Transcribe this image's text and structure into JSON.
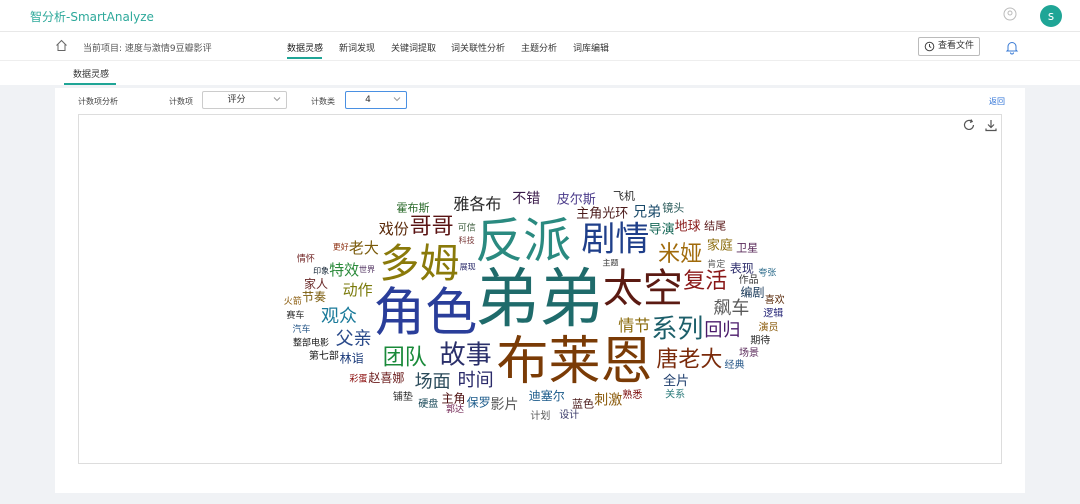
{
  "app": {
    "title": "智分析-SmartAnalyze",
    "avatar_letter": "s",
    "accent": "#1fa596"
  },
  "nav": {
    "project_label": "当前项目: 速度与激情9豆瓣影评",
    "tabs": [
      {
        "label": "数据灵感",
        "active": true
      },
      {
        "label": "新词发现"
      },
      {
        "label": "关键词提取"
      },
      {
        "label": "词关联性分析"
      },
      {
        "label": "主题分析"
      },
      {
        "label": "词库编辑"
      }
    ],
    "view_file_label": "查看文件"
  },
  "subnav": {
    "active_tab": "数据灵感"
  },
  "controls": {
    "section_label": "计数项分析",
    "count_item_label": "计数项",
    "count_item_value": "评分",
    "count_class_label": "计数类",
    "count_class_value": "4",
    "back_label": "返回"
  },
  "cloud": {
    "words": [
      {
        "t": "弟弟",
        "s": 64,
        "c": "#1f6b6b"
      },
      {
        "t": "布莱恩",
        "s": 52,
        "c": "#7a3b06"
      },
      {
        "t": "角色",
        "s": 52,
        "c": "#2a3e9a"
      },
      {
        "t": "反派",
        "s": 48,
        "c": "#2a8a80"
      },
      {
        "t": "太空",
        "s": 40,
        "c": "#5b1a12"
      },
      {
        "t": "多姆",
        "s": 40,
        "c": "#8a7a0a"
      },
      {
        "t": "剧情",
        "s": 34,
        "c": "#1f3f8a"
      },
      {
        "t": "故事",
        "s": 26,
        "c": "#2a2f6a"
      },
      {
        "t": "系列",
        "s": 26,
        "c": "#1d5f6a"
      },
      {
        "t": "米娅",
        "s": 22,
        "c": "#a06a0a"
      },
      {
        "t": "复活",
        "s": 22,
        "c": "#8a1818"
      },
      {
        "t": "团队",
        "s": 22,
        "c": "#1a8a3a"
      },
      {
        "t": "哥哥",
        "s": 22,
        "c": "#5a1414"
      },
      {
        "t": "唐老大",
        "s": 22,
        "c": "#7a2a0a"
      },
      {
        "t": "时间",
        "s": 18,
        "c": "#2a2a6a"
      },
      {
        "t": "飙车",
        "s": 18,
        "c": "#5a5a5a"
      },
      {
        "t": "回归",
        "s": 18,
        "c": "#4a1a6a"
      },
      {
        "t": "场面",
        "s": 18,
        "c": "#2a4a5a"
      },
      {
        "t": "父亲",
        "s": 18,
        "c": "#2a4a8a"
      },
      {
        "t": "情节",
        "s": 16,
        "c": "#8a6a0a"
      },
      {
        "t": "观众",
        "s": 18,
        "c": "#1a7a9a"
      },
      {
        "t": "动作",
        "s": 15,
        "c": "#7a7a0a"
      },
      {
        "t": "特效",
        "s": 15,
        "c": "#2a8a3a"
      },
      {
        "t": "老大",
        "s": 15,
        "c": "#7a5a0a"
      },
      {
        "t": "戏份",
        "s": 15,
        "c": "#5a2a0a"
      },
      {
        "t": "雅各布",
        "s": 16,
        "c": "#2a2a2a"
      },
      {
        "t": "主角光环",
        "s": 13,
        "c": "#4a1a1a"
      },
      {
        "t": "不错",
        "s": 14,
        "c": "#3a1a4a"
      },
      {
        "t": "兄弟",
        "s": 14,
        "c": "#1a4a6a"
      },
      {
        "t": "导演",
        "s": 13,
        "c": "#1a6a5a"
      },
      {
        "t": "皮尔斯",
        "s": 13,
        "c": "#4a3a8a"
      },
      {
        "t": "地球",
        "s": 13,
        "c": "#8a1a1a"
      },
      {
        "t": "迪塞尔",
        "s": 12,
        "c": "#1a5a8a"
      },
      {
        "t": "家庭",
        "s": 13,
        "c": "#8a6a0a"
      },
      {
        "t": "表现",
        "s": 12,
        "c": "#2a2a6a"
      },
      {
        "t": "全片",
        "s": 13,
        "c": "#1a3a6a"
      },
      {
        "t": "刺激",
        "s": 14,
        "c": "#8a5a0a"
      },
      {
        "t": "编剧",
        "s": 12,
        "c": "#1a3a5a"
      },
      {
        "t": "影片",
        "s": 14,
        "c": "#5a5a5a"
      },
      {
        "t": "保罗",
        "s": 12,
        "c": "#1a5a8a"
      },
      {
        "t": "主角",
        "s": 12,
        "c": "#4a0a0a"
      },
      {
        "t": "蓝色",
        "s": 11,
        "c": "#4a1a1a"
      },
      {
        "t": "赵喜娜",
        "s": 12,
        "c": "#6a1a1a"
      },
      {
        "t": "林诣",
        "s": 12,
        "c": "#1a3a7a"
      },
      {
        "t": "节奏",
        "s": 12,
        "c": "#7a5a0a"
      },
      {
        "t": "家人",
        "s": 12,
        "c": "#6a2a2a"
      },
      {
        "t": "霍布斯",
        "s": 11,
        "c": "#2a6a2a"
      },
      {
        "t": "飞机",
        "s": 11,
        "c": "#2a2a2a"
      },
      {
        "t": "镜头",
        "s": 11,
        "c": "#2a5a5a"
      },
      {
        "t": "结尾",
        "s": 11,
        "c": "#5a1a1a"
      },
      {
        "t": "卫星",
        "s": 11,
        "c": "#5a2a5a"
      },
      {
        "t": "作品",
        "s": 10,
        "c": "#3a3a3a"
      },
      {
        "t": "熟悉",
        "s": 10,
        "c": "#7a0a0a"
      },
      {
        "t": "喜欢",
        "s": 10,
        "c": "#5a2a0a"
      },
      {
        "t": "逻辑",
        "s": 10,
        "c": "#2a2a7a"
      },
      {
        "t": "演员",
        "s": 10,
        "c": "#8a5a0a"
      },
      {
        "t": "期待",
        "s": 10,
        "c": "#2a2a2a"
      },
      {
        "t": "场景",
        "s": 10,
        "c": "#5a2a5a"
      },
      {
        "t": "可信",
        "s": 9,
        "c": "#3a5a3a"
      },
      {
        "t": "经典",
        "s": 10,
        "c": "#2a5a8a"
      },
      {
        "t": "肯定",
        "s": 9,
        "c": "#5a5a5a"
      },
      {
        "t": "关系",
        "s": 10,
        "c": "#2a7a7a"
      },
      {
        "t": "设计",
        "s": 10,
        "c": "#3a3a6a"
      },
      {
        "t": "计划",
        "s": 10,
        "c": "#5a5a5a"
      },
      {
        "t": "硬盘",
        "s": 10,
        "c": "#1a4a5a"
      },
      {
        "t": "铺垫",
        "s": 10,
        "c": "#2a2a2a"
      },
      {
        "t": "夸张",
        "s": 9,
        "c": "#2a6a8a"
      },
      {
        "t": "整部电影",
        "s": 9,
        "c": "#1a1a1a"
      },
      {
        "t": "第七部",
        "s": 10,
        "c": "#1a1a1a"
      },
      {
        "t": "郭达",
        "s": 9,
        "c": "#6a1a4a"
      },
      {
        "t": "彩蛋",
        "s": 9,
        "c": "#8a0a0a"
      },
      {
        "t": "汽车",
        "s": 9,
        "c": "#2a5a8a"
      },
      {
        "t": "赛车",
        "s": 9,
        "c": "#2a2a2a"
      },
      {
        "t": "火箭",
        "s": 9,
        "c": "#8a5a0a"
      },
      {
        "t": "展现",
        "s": 8,
        "c": "#2a2a6a"
      },
      {
        "t": "主题",
        "s": 8,
        "c": "#3a3a3a"
      },
      {
        "t": "情怀",
        "s": 9,
        "c": "#6a1a1a"
      },
      {
        "t": "科技",
        "s": 8,
        "c": "#7a3a3a"
      },
      {
        "t": "世界",
        "s": 8,
        "c": "#4a2a5a"
      },
      {
        "t": "印象",
        "s": 8,
        "c": "#1a2a3a"
      },
      {
        "t": "更好",
        "s": 8,
        "c": "#8a2a0a"
      }
    ]
  }
}
